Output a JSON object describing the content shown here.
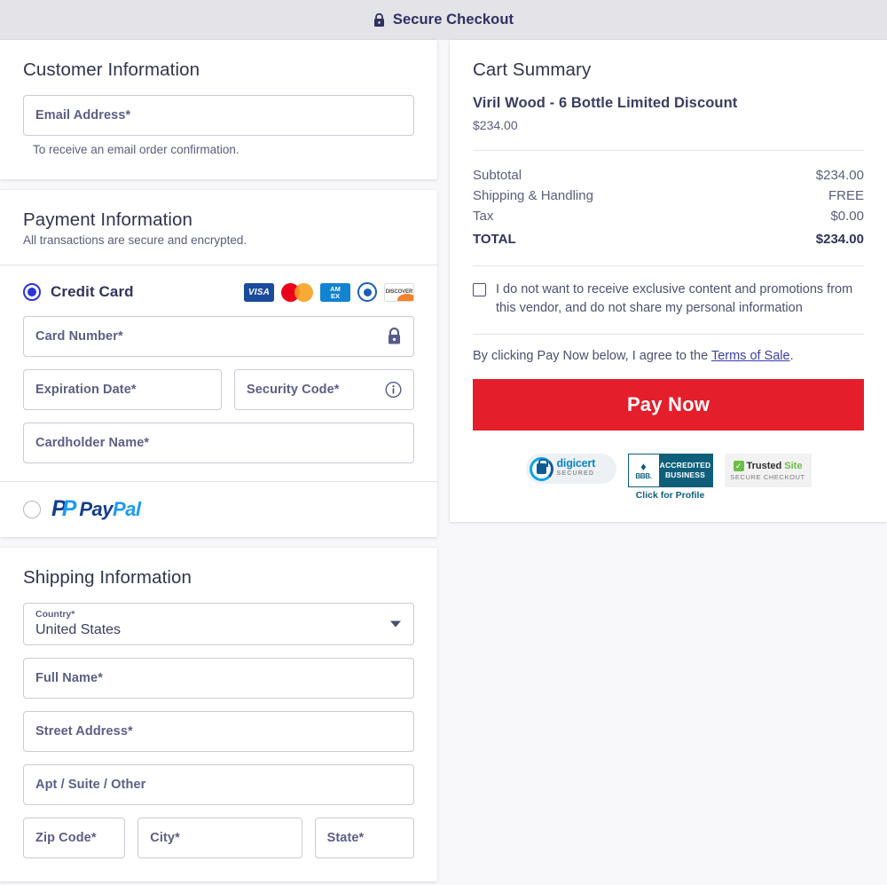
{
  "header": {
    "title": "Secure Checkout",
    "icon": "lock-icon"
  },
  "customer": {
    "title": "Customer Information",
    "email_placeholder": "Email Address*",
    "helper": "To receive an email order confirmation."
  },
  "payment": {
    "title": "Payment Information",
    "subtitle": "All transactions are secure and encrypted.",
    "methods": [
      {
        "label": "Credit Card",
        "selected": true
      },
      {
        "label": "PayPal",
        "selected": false
      }
    ],
    "card_brands": [
      "visa",
      "mastercard",
      "amex",
      "diners-club",
      "discover"
    ],
    "fields": {
      "card_number": "Card Number*",
      "expiration": "Expiration Date*",
      "security_code": "Security Code*",
      "cardholder": "Cardholder Name*"
    },
    "paypal_text": {
      "pay": "Pay",
      "pal": "Pal"
    }
  },
  "shipping": {
    "title": "Shipping Information",
    "country_label": "Country*",
    "country_value": "United States",
    "full_name": "Full Name*",
    "street": "Street Address*",
    "apt": "Apt / Suite / Other",
    "zip": "Zip Code*",
    "city": "City*",
    "state": "State*"
  },
  "cart": {
    "title": "Cart Summary",
    "product_name": "Viril Wood - 6 Bottle Limited Discount",
    "product_price": "$234.00",
    "totals": [
      {
        "label": "Subtotal",
        "value": "$234.00"
      },
      {
        "label": "Shipping & Handling",
        "value": "FREE"
      },
      {
        "label": "Tax",
        "value": "$0.00"
      },
      {
        "label": "TOTAL",
        "value": "$234.00"
      }
    ],
    "optout_text": "I do not want to receive exclusive content and promotions from this vendor, and do not share my personal information",
    "terms_prefix": "By clicking Pay Now below, I agree to the ",
    "terms_link": "Terms of Sale",
    "terms_suffix": ".",
    "pay_button": "Pay Now",
    "badges": {
      "digicert_name": "digicert",
      "digicert_sub": "SECURED",
      "bbb_line1": "ACCREDITED",
      "bbb_line2": "BUSINESS",
      "bbb_mark": "BBB.",
      "bbb_click": "Click for Profile",
      "ts_trusted": "Trusted",
      "ts_site": "Site",
      "ts_sub": "SECURE CHECKOUT"
    }
  },
  "colors": {
    "accent_red": "#e41e2b",
    "radio_blue": "#2b35d6",
    "header_bg": "#e3e3e8"
  },
  "brand_text": {
    "visa": "VISA",
    "amex_l1": "AM",
    "amex_l2": "EX",
    "discover": "DISCOVER"
  }
}
